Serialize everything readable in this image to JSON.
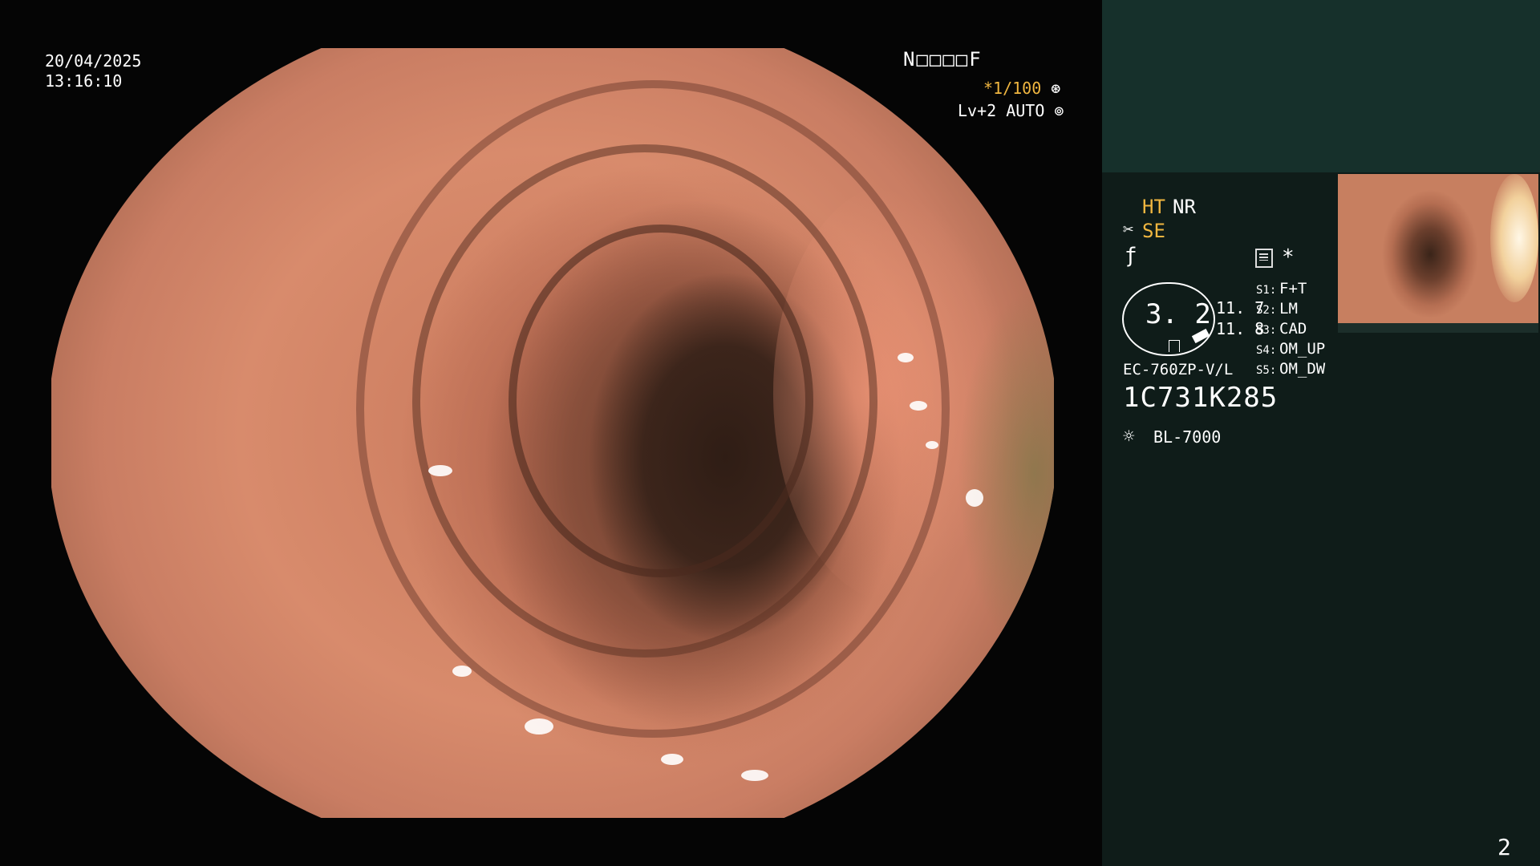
{
  "overlay": {
    "date": "20/04/2025",
    "time": "13:16:10",
    "patient_code": "N□□□□F",
    "shutter": "*1/100",
    "level": "Lv+2 AUTO"
  },
  "modes": {
    "ht": "HT",
    "nr": "NR",
    "se": "SE",
    "star": "*"
  },
  "zoom": {
    "value": "3. 2",
    "v1": "11. 7",
    "v2": "11. 8"
  },
  "switches": [
    {
      "key": "S1:",
      "value": "F+T"
    },
    {
      "key": "S2:",
      "value": "LM"
    },
    {
      "key": "S3:",
      "value": "CAD"
    },
    {
      "key": "S4:",
      "value": "OM_UP"
    },
    {
      "key": "S5:",
      "value": "OM_DW"
    }
  ],
  "device": {
    "scope_model": "EC-760ZP-V/L",
    "serial": "1C731K285",
    "light_source": "BL-7000"
  },
  "page_number": "2",
  "icons": {
    "shutter": "aperture-icon",
    "level": "iris-icon",
    "structure": "scissor-icon",
    "filter": "slash-f-icon",
    "memory": "memory-icon",
    "light": "sun-icon"
  }
}
